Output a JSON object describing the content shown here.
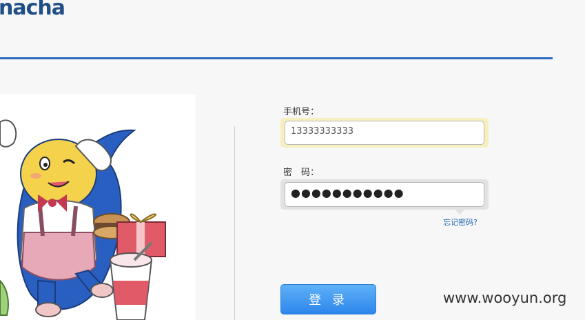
{
  "header": {
    "logo_text": "nacha",
    "rule_color": "#2a6ac1"
  },
  "form": {
    "phone_label": "手机号：",
    "phone_value": "13333333333",
    "password_label": "密　码：",
    "password_mask": "●●●●●●●●●●●",
    "forgot_link": "忘记密码?",
    "login_button": "登 录"
  },
  "illustration": {
    "name": "mascot-illustration"
  },
  "watermark": "www.wooyun.org",
  "colors": {
    "accent": "#2a6ac1",
    "focus_glow": "#f7efbd",
    "link": "#1e66b5"
  }
}
